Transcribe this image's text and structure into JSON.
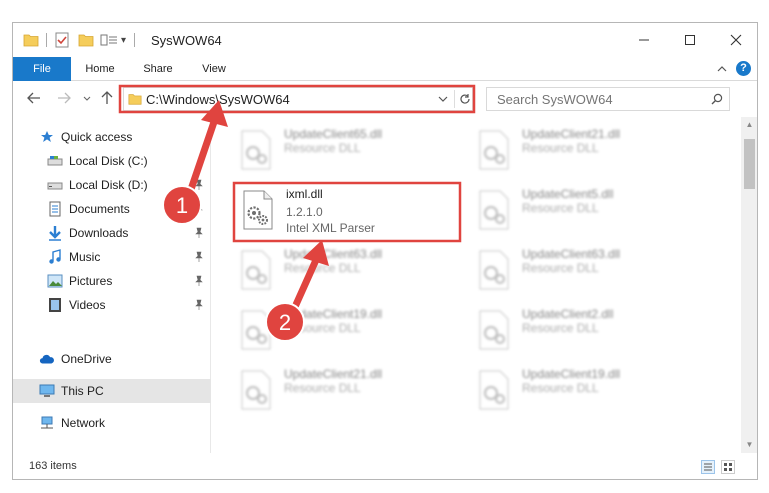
{
  "window": {
    "title": "SysWOW64",
    "qa_dropdown": "▾"
  },
  "ribbon": {
    "tabs": [
      "File",
      "Home",
      "Share",
      "View"
    ],
    "help": "?"
  },
  "navbar": {
    "address": "C:\\Windows\\SysWOW64",
    "search_placeholder": "Search SysWOW64"
  },
  "sidebar": {
    "items": [
      {
        "label": "Quick access",
        "icon": "star-icon"
      },
      {
        "label": "Local Disk (C:)",
        "icon": "drive-icon"
      },
      {
        "label": "Local Disk (D:)",
        "icon": "drive-icon"
      },
      {
        "label": "Documents",
        "icon": "documents-icon"
      },
      {
        "label": "Downloads",
        "icon": "download-icon"
      },
      {
        "label": "Music",
        "icon": "music-icon"
      },
      {
        "label": "Pictures",
        "icon": "pictures-icon"
      },
      {
        "label": "Videos",
        "icon": "videos-icon"
      },
      {
        "label": "OneDrive",
        "icon": "cloud-icon"
      },
      {
        "label": "This PC",
        "icon": "computer-icon"
      },
      {
        "label": "Network",
        "icon": "network-icon"
      }
    ]
  },
  "files": [
    {
      "name": "UpdateClient65.dll",
      "desc": "Resource DLL"
    },
    {
      "name": "UpdateClient21.dll",
      "desc": "Resource DLL"
    },
    {
      "name": "ixml.dll",
      "version": "1.2.1.0",
      "desc": "Intel XML Parser"
    },
    {
      "name": "UpdateClient5.dll",
      "desc": "Resource DLL"
    },
    {
      "name": "UpdateClient63.dll",
      "desc": "Resource DLL"
    },
    {
      "name": "UpdateClient63.dll",
      "desc": "Resource DLL"
    },
    {
      "name": "UpdateClient19.dll",
      "desc": "Resource DLL"
    },
    {
      "name": "UpdateClient2.dll",
      "desc": "Resource DLL"
    },
    {
      "name": "UpdateClient21.dll",
      "desc": "Resource DLL"
    },
    {
      "name": "UpdateClient19.dll",
      "desc": "Resource DLL"
    }
  ],
  "status": {
    "count": "163 items"
  },
  "annotations": {
    "badge1": "1",
    "badge2": "2"
  },
  "colors": {
    "accent": "#1979ca",
    "annotation_red": "#e0443f"
  }
}
